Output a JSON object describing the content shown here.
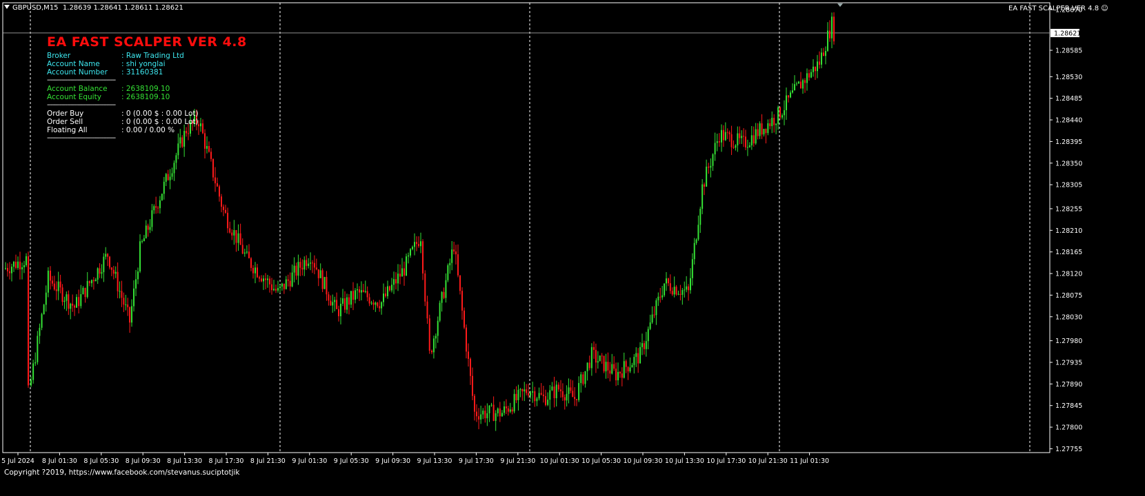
{
  "header": {
    "symbol": "GBPUSD,M15",
    "ohlc": "1.28639 1.28641 1.28611 1.28621"
  },
  "ea_label": "EA FAST SCALPER VER 4.8",
  "panel": {
    "title": "EA FAST SCALPER VER 4.8",
    "separator": "--------------------------------------",
    "rows_account": [
      {
        "key": "Broker",
        "value": ": Raw Trading Ltd"
      },
      {
        "key": "Account Name",
        "value": ": shi yonglai"
      },
      {
        "key": "Account Number",
        "value": ": 31160381"
      }
    ],
    "rows_balance": [
      {
        "key": "Account Balance",
        "value": ": 2638109.10"
      },
      {
        "key": "Account Equity",
        "value": ": 2638109.10"
      }
    ],
    "rows_orders": [
      {
        "key": "Order Buy",
        "value": ": 0 (0.00 $ : 0.00 Lot)"
      },
      {
        "key": "Order Sell",
        "value": ": 0 (0.00 $ : 0.00 Lot)"
      },
      {
        "key": "Floating All",
        "value": ": 0.00 / 0.00 %"
      }
    ]
  },
  "copyright": "Copyright ?2019, https://www.facebook.com/stevanus.suciptotjik",
  "colors": {
    "bull": "#35e235",
    "bear": "#ff1a1a",
    "info_cyan": "#3ee8f0",
    "title_red": "#ff0d0d",
    "grid": "#ffffff",
    "axis": "#ffffff",
    "background": "#000000"
  },
  "chart_data": {
    "type": "candlestick",
    "title": "GBPUSD,M15",
    "current_price": 1.28621,
    "current_price_label": "1.28621",
    "ylim": [
      1.27747,
      1.28684
    ],
    "y_ticks": [
      "1.28670",
      "1.28585",
      "1.28530",
      "1.28485",
      "1.28440",
      "1.28395",
      "1.28350",
      "1.28305",
      "1.28255",
      "1.28210",
      "1.28165",
      "1.28120",
      "1.28075",
      "1.28030",
      "1.27980",
      "1.27935",
      "1.27890",
      "1.27845",
      "1.27800",
      "1.27755"
    ],
    "x_ticks": [
      "5 Jul 2024",
      "8 Jul 01:30",
      "8 Jul 05:30",
      "8 Jul 09:30",
      "8 Jul 13:30",
      "8 Jul 17:30",
      "8 Jul 21:30",
      "9 Jul 01:30",
      "9 Jul 05:30",
      "9 Jul 09:30",
      "9 Jul 13:30",
      "9 Jul 17:30",
      "9 Jul 21:30",
      "10 Jul 01:30",
      "10 Jul 05:30",
      "10 Jul 09:30",
      "10 Jul 13:30",
      "10 Jul 17:30",
      "10 Jul 21:30",
      "11 Jul 01:30"
    ],
    "day_separators": [
      "8 Jul 2024",
      "9 Jul 2024",
      "10 Jul 2024",
      "11 Jul 2024",
      "12 Jul 2024"
    ],
    "close_path": [
      {
        "t": "5 Jul 2024",
        "close": 1.2813
      },
      {
        "t": "5 Jul 2024 late",
        "close": 1.2815
      },
      {
        "t": "8 Jul 00:00",
        "close": 1.2787
      },
      {
        "t": "8 Jul 01:30",
        "close": 1.2811
      },
      {
        "t": "8 Jul 03:30",
        "close": 1.2805
      },
      {
        "t": "8 Jul 05:30",
        "close": 1.281
      },
      {
        "t": "8 Jul 07:30",
        "close": 1.2816
      },
      {
        "t": "8 Jul 09:30",
        "close": 1.2802
      },
      {
        "t": "8 Jul 11:30",
        "close": 1.2817
      },
      {
        "t": "8 Jul 13:30",
        "close": 1.2826
      },
      {
        "t": "8 Jul 15:00",
        "close": 1.2842
      },
      {
        "t": "8 Jul 16:00",
        "close": 1.2844
      },
      {
        "t": "8 Jul 17:30",
        "close": 1.2825
      },
      {
        "t": "8 Jul 19:30",
        "close": 1.2815
      },
      {
        "t": "8 Jul 21:30",
        "close": 1.2808
      },
      {
        "t": "9 Jul 01:30",
        "close": 1.2816
      },
      {
        "t": "9 Jul 05:30",
        "close": 1.2804
      },
      {
        "t": "9 Jul 07:30",
        "close": 1.2808
      },
      {
        "t": "9 Jul 09:30",
        "close": 1.2806
      },
      {
        "t": "9 Jul 11:30",
        "close": 1.2813
      },
      {
        "t": "9 Jul 13:30",
        "close": 1.282
      },
      {
        "t": "9 Jul 14:30",
        "close": 1.2795
      },
      {
        "t": "9 Jul 15:30",
        "close": 1.2818
      },
      {
        "t": "9 Jul 17:30",
        "close": 1.2783
      },
      {
        "t": "9 Jul 19:30",
        "close": 1.2783
      },
      {
        "t": "9 Jul 21:30",
        "close": 1.2788
      },
      {
        "t": "9 Jul 23:00",
        "close": 1.2786
      },
      {
        "t": "10 Jul 01:30",
        "close": 1.2788
      },
      {
        "t": "10 Jul 03:30",
        "close": 1.2786
      },
      {
        "t": "10 Jul 05:30",
        "close": 1.2795
      },
      {
        "t": "10 Jul 07:30",
        "close": 1.2791
      },
      {
        "t": "10 Jul 09:30",
        "close": 1.2795
      },
      {
        "t": "10 Jul 11:30",
        "close": 1.281
      },
      {
        "t": "10 Jul 13:30",
        "close": 1.2808
      },
      {
        "t": "10 Jul 15:30",
        "close": 1.283
      },
      {
        "t": "10 Jul 17:30",
        "close": 1.2841
      },
      {
        "t": "10 Jul 19:30",
        "close": 1.2839
      },
      {
        "t": "10 Jul 21:30",
        "close": 1.2845
      },
      {
        "t": "11 Jul 00:00",
        "close": 1.2851
      },
      {
        "t": "11 Jul 01:30",
        "close": 1.2856
      },
      {
        "t": "11 Jul 02:30",
        "close": 1.2864
      },
      {
        "t": "11 Jul 02:45",
        "close": 1.28621
      }
    ]
  }
}
